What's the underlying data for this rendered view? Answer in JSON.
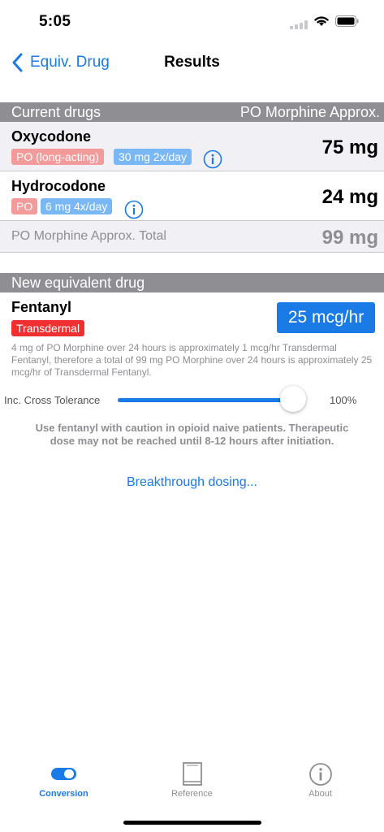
{
  "status_bar": {
    "time": "5:05"
  },
  "nav": {
    "back_label": "Equiv. Drug",
    "title": "Results"
  },
  "current_drugs": {
    "header_left": "Current drugs",
    "header_right": "PO Morphine Approx.",
    "items": [
      {
        "name": "Oxycodone",
        "route": "PO (long-acting)",
        "dose": "30 mg 2x/day",
        "morphine": "75 mg"
      },
      {
        "name": "Hydrocodone",
        "route": "PO",
        "dose": "6 mg 4x/day",
        "morphine": "24 mg"
      }
    ],
    "total_label": "PO Morphine Approx. Total",
    "total_value": "99 mg"
  },
  "new_drug": {
    "header": "New equivalent drug",
    "name": "Fentanyl",
    "route": "Transdermal",
    "dose": "25 mcg/hr",
    "explanation": "4 mg of PO Morphine over 24 hours is approximately 1 mcg/hr Transdermal Fentanyl, therefore a total of 99 mg PO Morphine over 24 hours is approximately 25 mcg/hr of Transdermal Fentanyl."
  },
  "cross_tolerance": {
    "label": "Inc. Cross Tolerance",
    "value_text": "100%",
    "value": 1.0
  },
  "caution": "Use fentanyl with caution in opioid naive patients. Therapeutic dose may not be reached until 8-12 hours after initiation.",
  "breakthrough_link": "Breakthrough dosing...",
  "tabs": [
    {
      "label": "Conversion",
      "icon": "pill-toggle-icon",
      "active": true
    },
    {
      "label": "Reference",
      "icon": "book-icon",
      "active": false
    },
    {
      "label": "About",
      "icon": "info-circle-icon",
      "active": false
    }
  ],
  "colors": {
    "accent": "#1a7ae6",
    "section_header": "#8e8e93",
    "route_badge": "#f39a9a",
    "dose_badge": "#7ab7f5",
    "transdermal_badge": "#f03030"
  }
}
